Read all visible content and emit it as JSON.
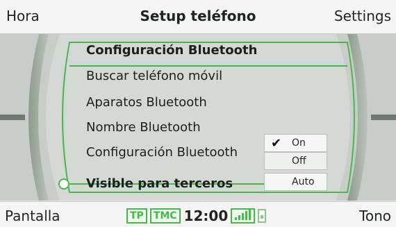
{
  "header": {
    "left": "Hora",
    "title": "Setup teléfono",
    "right": "Settings"
  },
  "menu": {
    "items": [
      {
        "label": "Configuración Bluetooth",
        "bold": true
      },
      {
        "label": "Buscar teléfono móvil",
        "bold": false
      },
      {
        "label": "Aparatos Bluetooth",
        "bold": false
      },
      {
        "label": "Nombre Bluetooth",
        "bold": false
      },
      {
        "label": "Configuración Bluetooth",
        "bold": false
      },
      {
        "label": "Visible para terceros",
        "bold": true
      }
    ]
  },
  "dropdown": {
    "options": [
      "On",
      "Off",
      "Auto"
    ],
    "selected": "On"
  },
  "footer": {
    "left": "Pantalla",
    "right": "Tono",
    "badges": [
      "TP",
      "TMC"
    ],
    "time": "12:00",
    "signal_level": 5
  },
  "colors": {
    "accent": "#47b84c",
    "bezel": "#8fa08f",
    "background": "#d6d8d5"
  }
}
